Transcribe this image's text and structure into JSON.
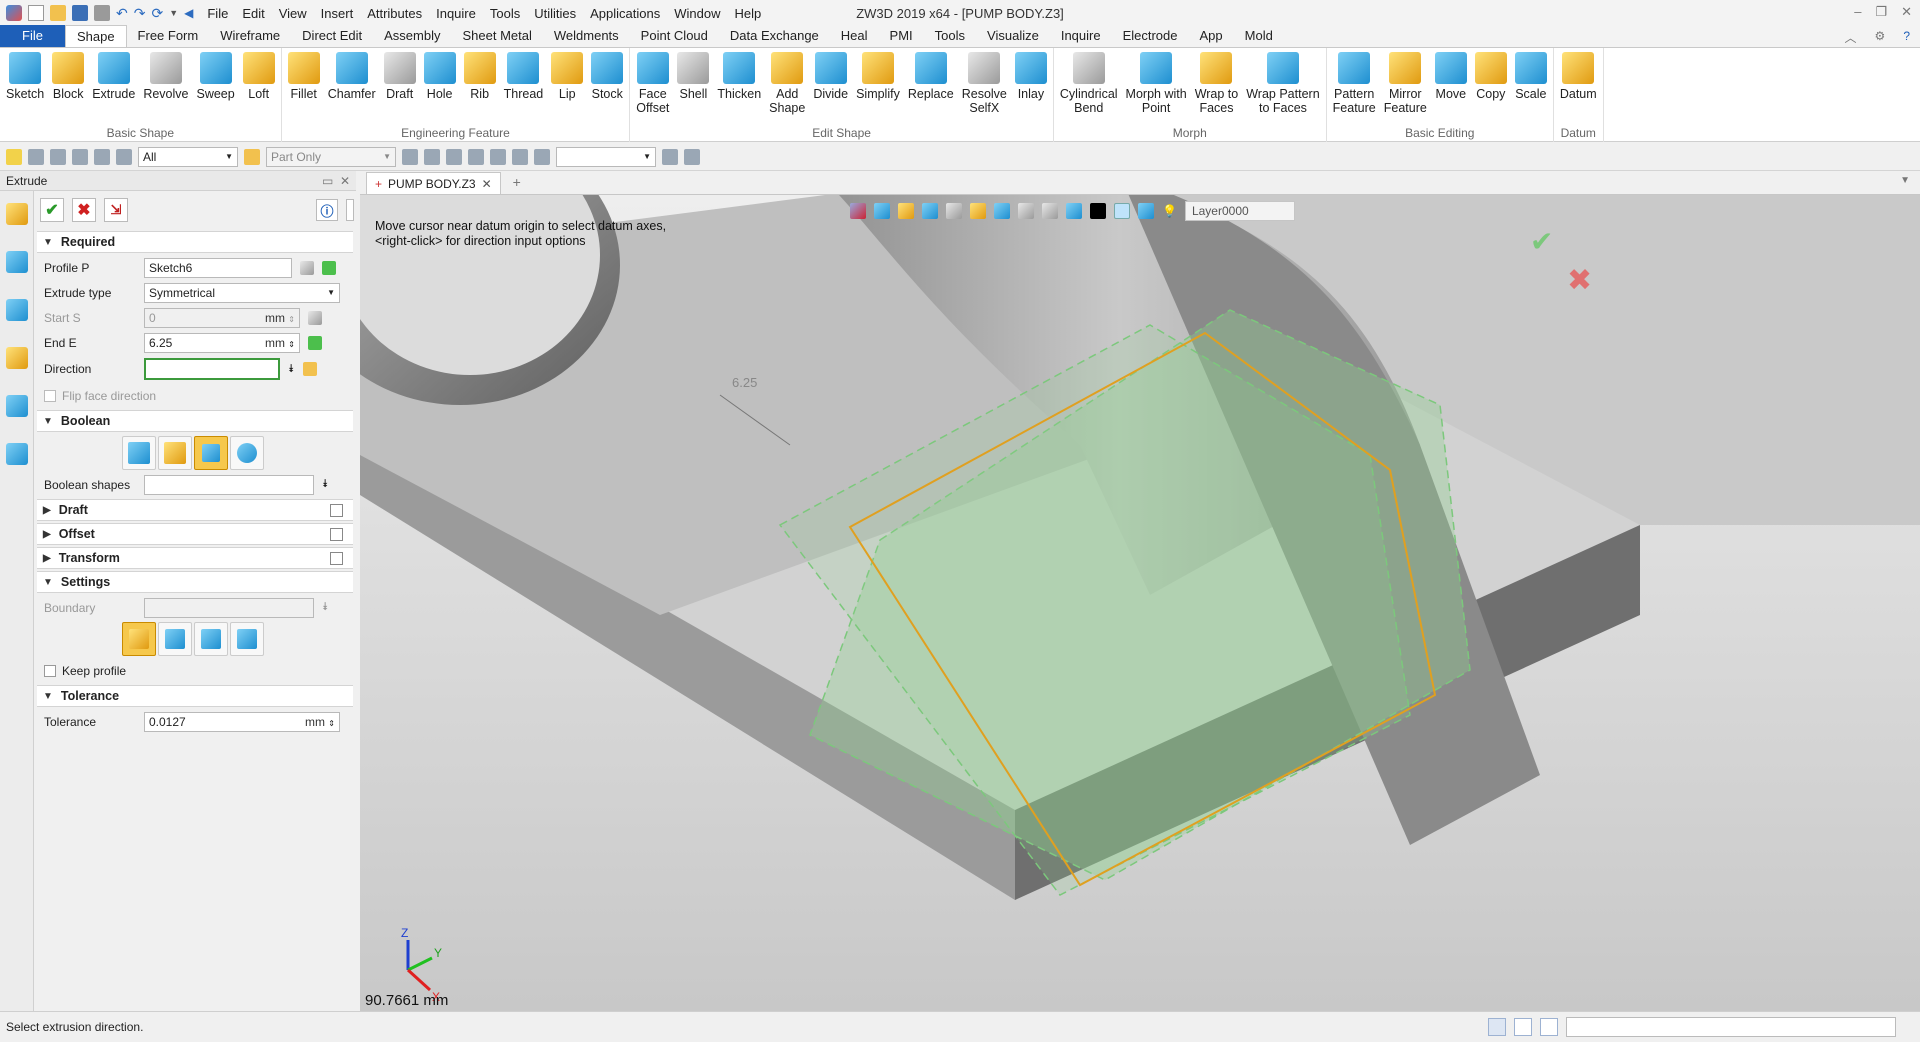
{
  "app_title": "ZW3D 2019  x64 - [PUMP BODY.Z3]",
  "menu": [
    "File",
    "Edit",
    "View",
    "Insert",
    "Attributes",
    "Inquire",
    "Tools",
    "Utilities",
    "Applications",
    "Window",
    "Help"
  ],
  "ribbon_tabs": [
    "File",
    "Shape",
    "Free Form",
    "Wireframe",
    "Direct Edit",
    "Assembly",
    "Sheet Metal",
    "Weldments",
    "Point Cloud",
    "Data Exchange",
    "Heal",
    "PMI",
    "Tools",
    "Visualize",
    "Inquire",
    "Electrode",
    "App",
    "Mold"
  ],
  "active_tab": "Shape",
  "ribbon_groups": [
    {
      "label": "Basic Shape",
      "buttons": [
        "Sketch",
        "Block",
        "Extrude",
        "Revolve",
        "Sweep",
        "Loft"
      ]
    },
    {
      "label": "Engineering Feature",
      "buttons": [
        "Fillet",
        "Chamfer",
        "Draft",
        "Hole",
        "Rib",
        "Thread",
        "Lip",
        "Stock"
      ]
    },
    {
      "label": "Edit Shape",
      "buttons": [
        "Face\nOffset",
        "Shell",
        "Thicken",
        "Add\nShape",
        "Divide",
        "Simplify",
        "Replace",
        "Resolve\nSelfX",
        "Inlay"
      ]
    },
    {
      "label": "Morph",
      "buttons": [
        "Cylindrical\nBend",
        "Morph with\nPoint",
        "Wrap to\nFaces",
        "Wrap Pattern\nto Faces"
      ]
    },
    {
      "label": "Basic Editing",
      "buttons": [
        "Pattern\nFeature",
        "Mirror\nFeature",
        "Move",
        "Copy",
        "Scale"
      ]
    },
    {
      "label": "Datum",
      "buttons": [
        "Datum"
      ]
    }
  ],
  "toolbar": {
    "filter_value": "All",
    "scope_value": "Part Only",
    "extra_value": ""
  },
  "panel": {
    "title": "Extrude",
    "required_label": "Required",
    "profile_label": "Profile P",
    "profile_value": "Sketch6",
    "extrude_type_label": "Extrude type",
    "extrude_type_value": "Symmetrical",
    "start_label": "Start S",
    "start_value": "0",
    "end_label": "End E",
    "end_value": "6.25",
    "direction_label": "Direction",
    "direction_value": "",
    "unit": "mm",
    "flip_label": "Flip face direction",
    "boolean_label": "Boolean",
    "boolean_shapes_label": "Boolean shapes",
    "draft_label": "Draft",
    "offset_label": "Offset",
    "transform_label": "Transform",
    "settings_label": "Settings",
    "boundary_label": "Boundary",
    "keep_profile_label": "Keep profile",
    "tolerance_section_label": "Tolerance",
    "tolerance_label": "Tolerance",
    "tolerance_value": "0.0127"
  },
  "doc_tab": "PUMP BODY.Z3",
  "viewport": {
    "hint_line1": "Move cursor near datum origin to select datum axes,",
    "hint_line2": "<right-click> for direction input options",
    "dim_label": "6.25",
    "measure": "90.7661 mm",
    "layer": "Layer0000",
    "axis_x": "X",
    "axis_y": "Y",
    "axis_z": "Z"
  },
  "status_text": "Select extrusion direction.",
  "colors": {
    "file_tab": "#1e5fb8",
    "preview_green": "#8fd08f",
    "profile_orange": "#e0a020",
    "model_gray": "#b4b4b4"
  }
}
